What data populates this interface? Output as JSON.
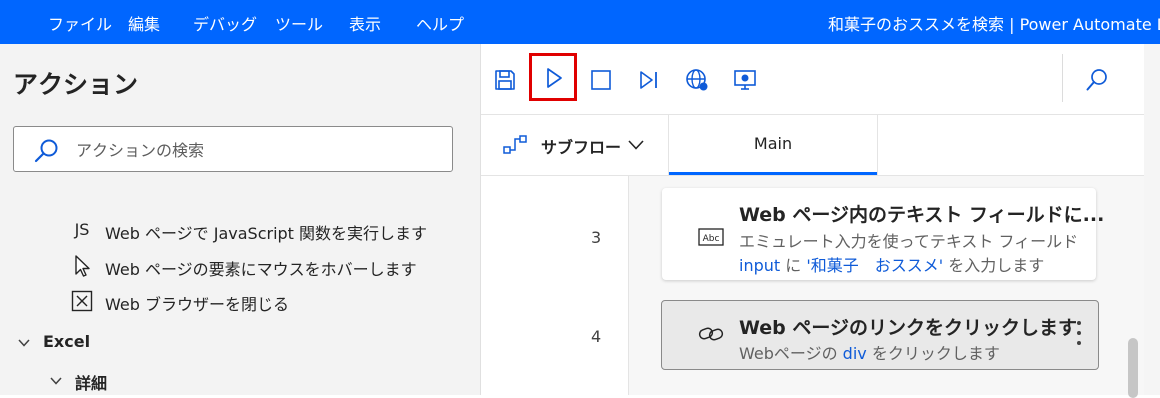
{
  "menu": {
    "items": [
      "ファイル",
      "編集",
      "デバッグ",
      "ツール",
      "表示",
      "ヘルプ"
    ],
    "window_title": "和菓子のおススメを検索 | Power Automate D"
  },
  "actions_pane": {
    "title": "アクション",
    "search_placeholder": "アクションの検索",
    "items": [
      {
        "icon": "js-icon",
        "icon_text": "JS",
        "label": "Web ページで JavaScript 関数を実行します"
      },
      {
        "icon": "cursor-icon",
        "label": "Web ページの要素にマウスをホバーします"
      },
      {
        "icon": "close-box-icon",
        "label": "Web ブラウザーを閉じる"
      }
    ],
    "groups": [
      {
        "label": "Excel",
        "expanded": true
      },
      {
        "label": "詳細",
        "expanded": true
      }
    ]
  },
  "toolbar": {
    "buttons": [
      "save-icon",
      "run-icon",
      "stop-icon",
      "run-next-icon",
      "web-recorder-icon",
      "desktop-recorder-icon",
      "search-icon"
    ],
    "highlighted": "run-icon"
  },
  "tabs": {
    "subflow_label": "サブフロー",
    "main_label": "Main"
  },
  "flow": {
    "steps": [
      {
        "number": "3",
        "icon": "abc-icon",
        "icon_text": "Abc",
        "title": "Web ページ内のテキスト フィールドに...",
        "desc_line1": "エミュレート入力を使ってテキスト フィールド",
        "desc_line2_var": "input",
        "desc_line2_mid": " に ",
        "desc_line2_val": "'和菓子　おススメ'",
        "desc_line2_end": " を入力します"
      },
      {
        "number": "4",
        "icon": "link-icon",
        "title": "Web ページのリンクをクリックします",
        "desc_start": "Webページの ",
        "desc_var": "div",
        "desc_end": " をクリックします",
        "selected": true
      }
    ]
  },
  "colors": {
    "menubar": "#0066ff",
    "accent": "#0f5bd8",
    "highlight_box": "#e00000"
  }
}
